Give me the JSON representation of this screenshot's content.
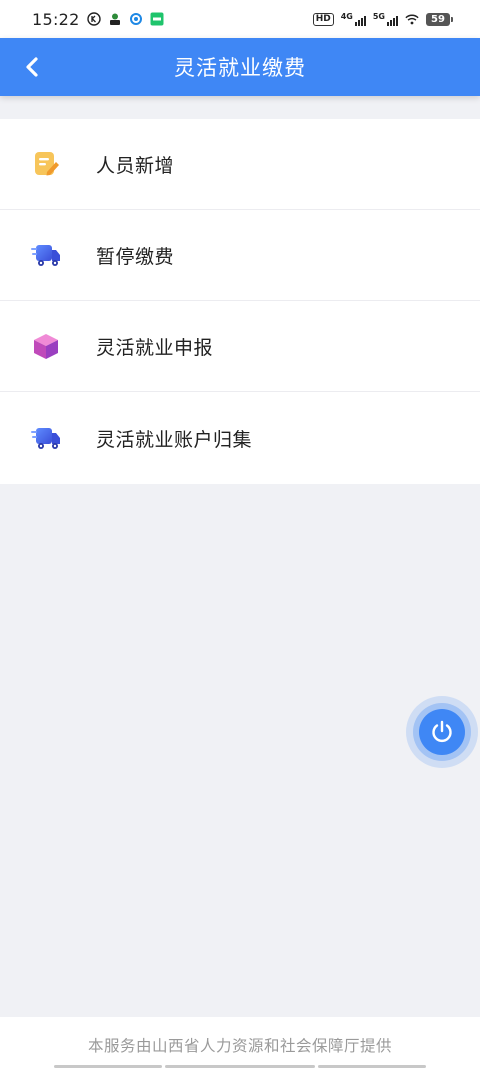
{
  "status_bar": {
    "time": "15:22",
    "hd": "HD",
    "network_4g": "4G",
    "network_5g": "5G",
    "battery": "59"
  },
  "header": {
    "title": "灵活就业缴费"
  },
  "menu": {
    "items": [
      {
        "label": "人员新增",
        "icon": "edit-document-icon",
        "color": "#f5b944"
      },
      {
        "label": "暂停缴费",
        "icon": "delivery-truck-icon",
        "color": "#4a6cf0"
      },
      {
        "label": "灵活就业申报",
        "icon": "cube-box-icon",
        "color": "#d94fc4"
      },
      {
        "label": "灵活就业账户归集",
        "icon": "delivery-truck-icon",
        "color": "#4a6cf0"
      }
    ]
  },
  "fab": {
    "icon": "power-icon",
    "color": "#3f87f5"
  },
  "footer": {
    "text": "本服务由山西省人力资源和社会保障厅提供"
  },
  "colors": {
    "accent": "#3f87f5",
    "background": "#f0f1f5"
  }
}
